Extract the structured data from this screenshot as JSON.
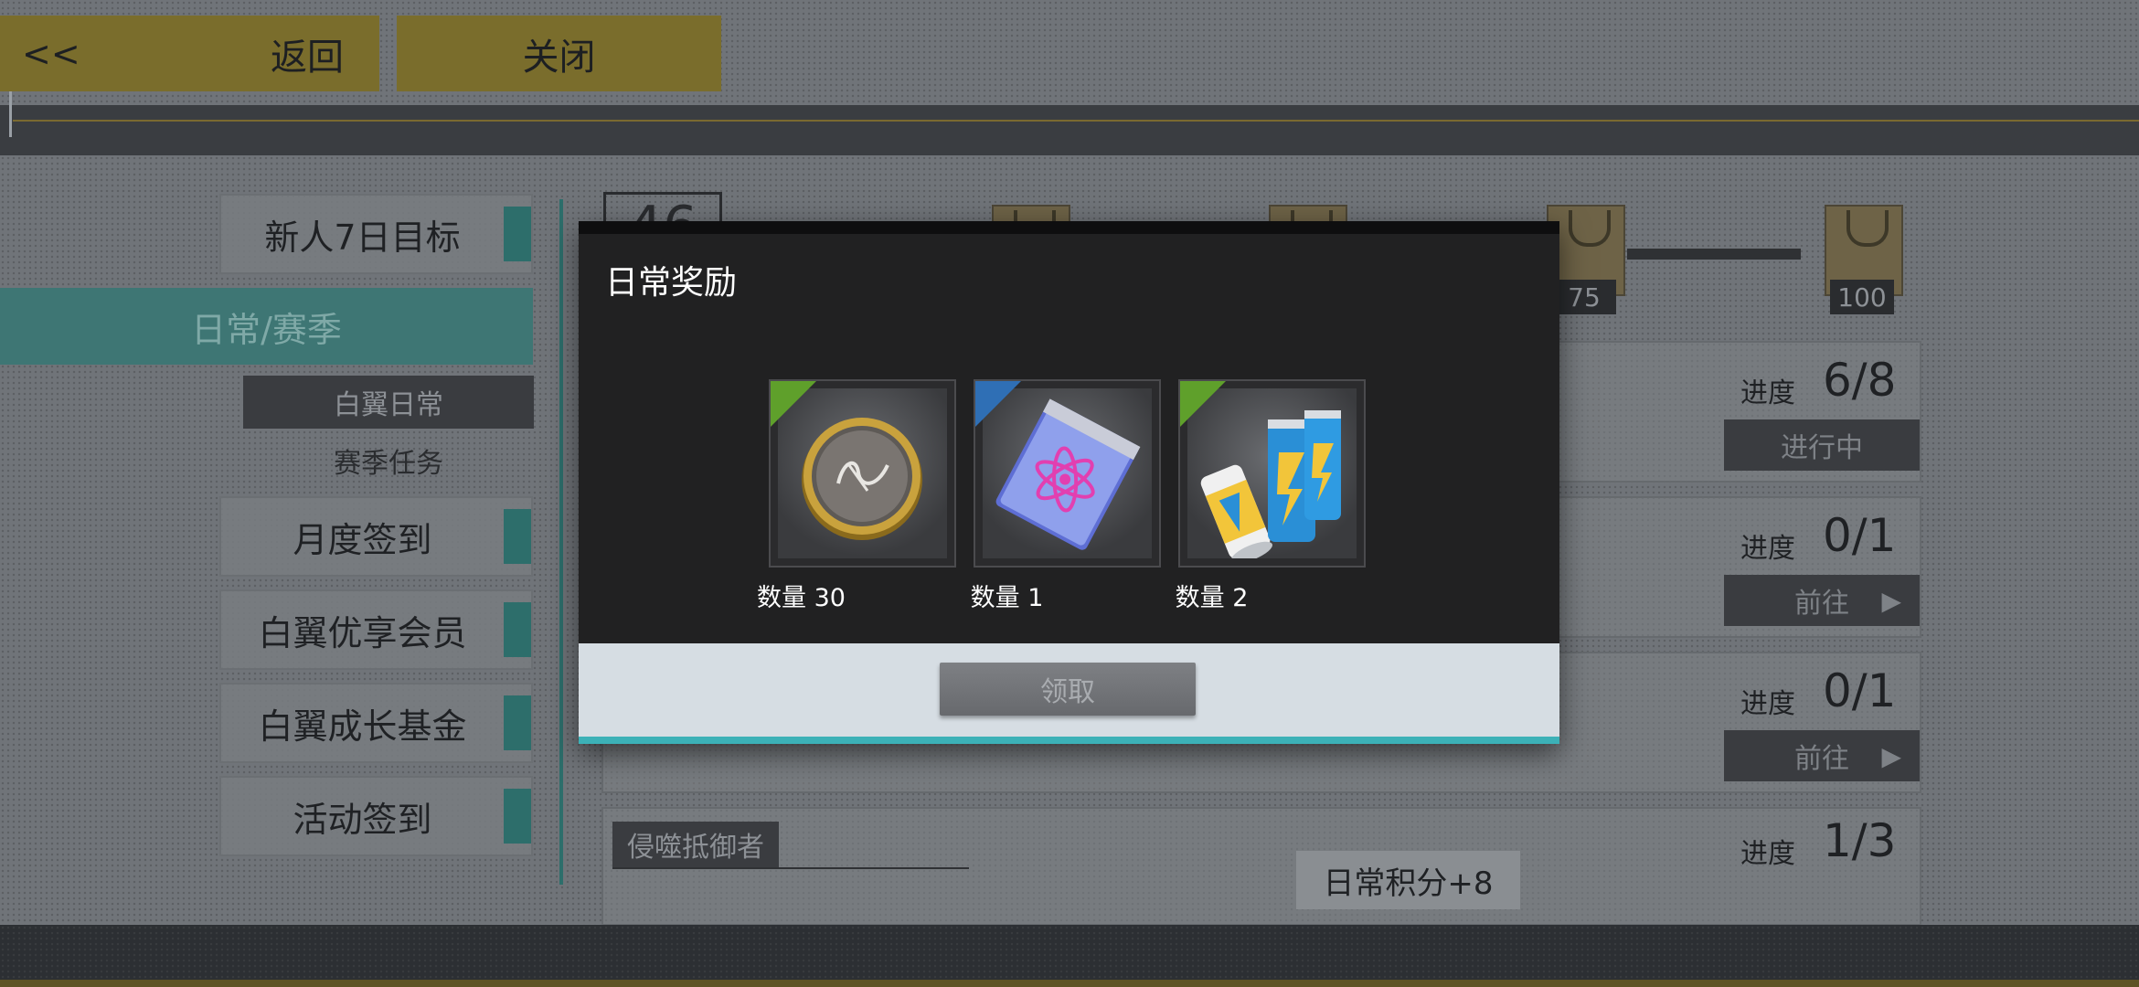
{
  "top_bar": {
    "back_arrow": "<<",
    "back_label": "返回",
    "close_label": "关闭"
  },
  "sidebar": {
    "items": [
      {
        "label": "新人7日目标",
        "active": false
      },
      {
        "label": "日常/赛季",
        "active": true
      },
      {
        "label": "月度签到",
        "active": false
      },
      {
        "label": "白翼优享会员",
        "active": false
      },
      {
        "label": "白翼成长基金",
        "active": false
      },
      {
        "label": "活动签到",
        "active": false
      }
    ],
    "subitems": [
      {
        "label": "白翼日常",
        "selected": true
      },
      {
        "label": "赛季任务",
        "selected": false
      }
    ]
  },
  "milestones": {
    "current_points": "46",
    "thresholds": [
      "75",
      "100"
    ]
  },
  "tasks": [
    {
      "progress_label": "进度",
      "progress": "6/8",
      "action": "进行中"
    },
    {
      "progress_label": "进度",
      "progress": "0/1",
      "action": "前往"
    },
    {
      "progress_label": "进度",
      "progress": "0/1",
      "action": "前往"
    },
    {
      "title": "侵噬抵御者",
      "progress_label": "进度",
      "progress": "1/3",
      "score": "日常积分+8"
    }
  ],
  "modal": {
    "title": "日常奖励",
    "rewards": [
      {
        "icon": "coin-icon",
        "quantity_text": "数量 30",
        "corner_color": "#5fa02b"
      },
      {
        "icon": "atom-pack-icon",
        "quantity_text": "数量 1",
        "corner_color": "#2f6fb5"
      },
      {
        "icon": "energy-drink-icon",
        "quantity_text": "数量 2",
        "corner_color": "#5fa02b"
      }
    ],
    "claim_label": "领取"
  },
  "colors": {
    "accent_teal": "#3cb1b7",
    "top_button_gold": "#7a6d2c",
    "sidebar_tab": "#2d6e6b"
  }
}
